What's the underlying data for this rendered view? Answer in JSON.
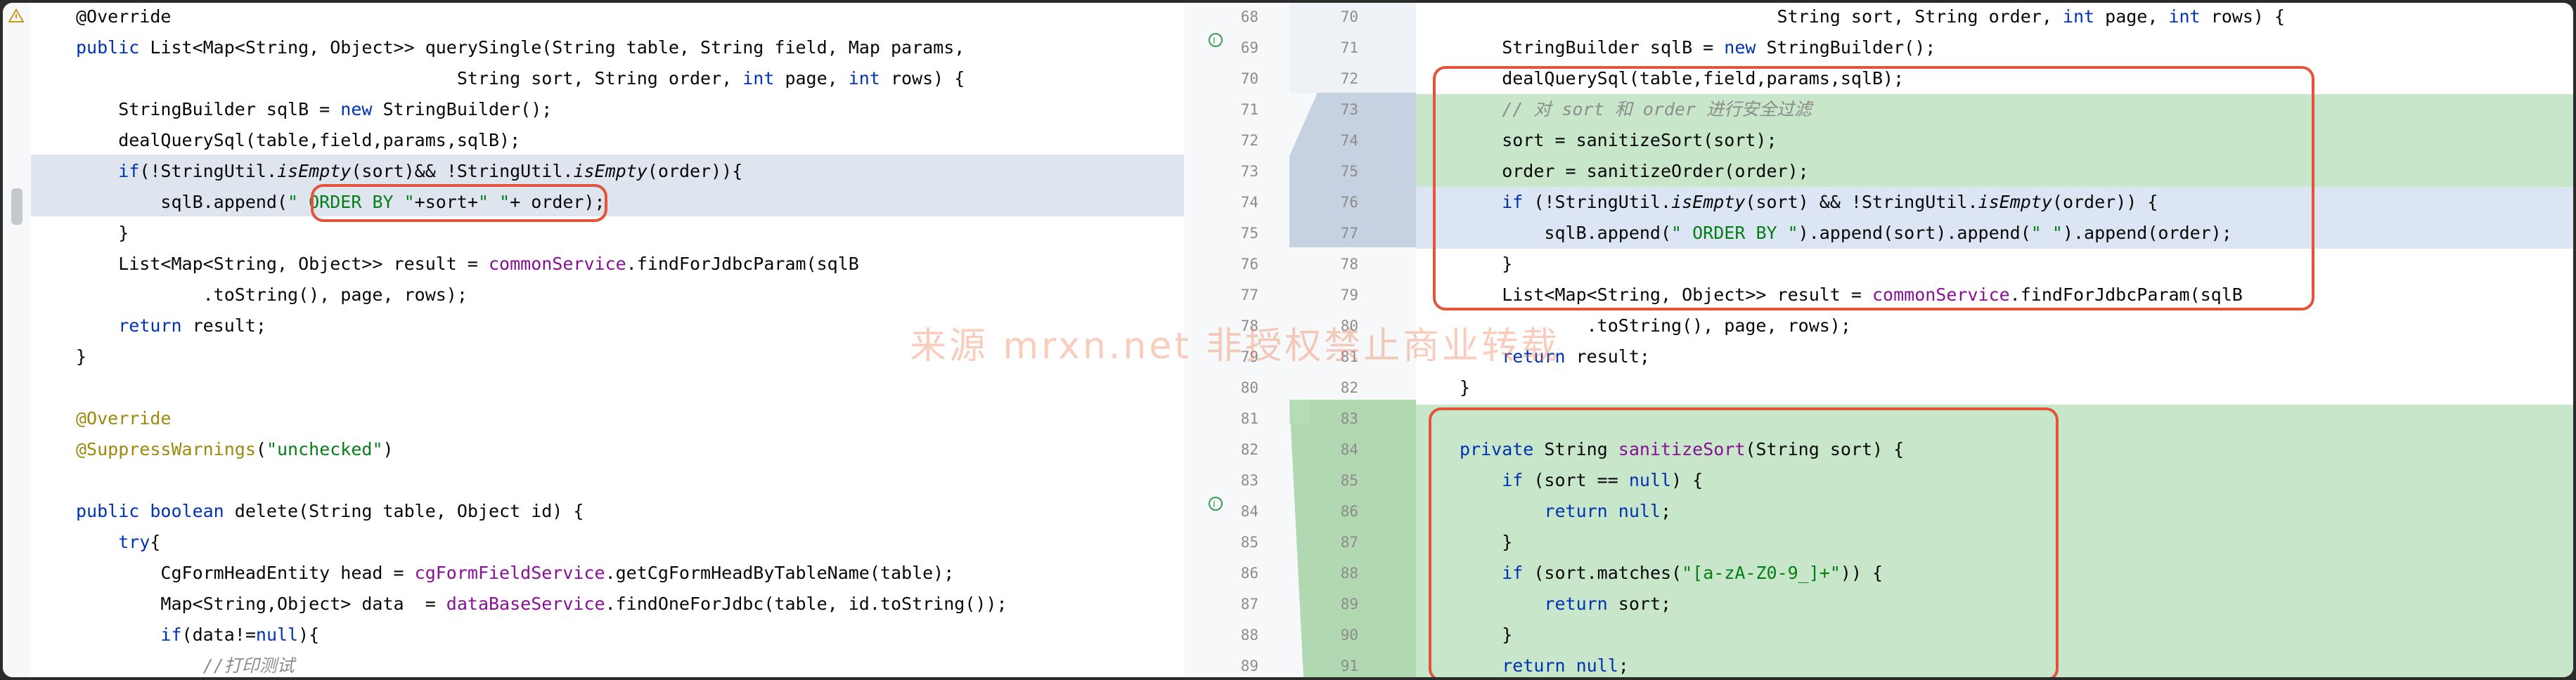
{
  "left_code": [
    {
      "n": "",
      "t": "@Override",
      "kind": "ann"
    },
    {
      "n": "69",
      "html": "<span class='kw'>public</span> List&lt;Map&lt;String, Object&gt;&gt; querySingle(String table, String field, Map params,"
    },
    {
      "n": "70",
      "html": "                                    String sort, String order, <span class='kw'>int</span> page, <span class='kw'>int</span> rows) {"
    },
    {
      "n": "71",
      "html": "    StringBuilder sqlB = <span class='kw'>new</span> StringBuilder();"
    },
    {
      "n": "72",
      "html": "    dealQuerySql(table,field,params,sqlB);"
    },
    {
      "n": "73",
      "html": "    <span class='kw'>if</span>(!StringUtil.<span class='it'>isEmpty</span>(sort)&amp;&amp; !StringUtil.<span class='it'>isEmpty</span>(order)){"
    },
    {
      "n": "74",
      "html": "        sqlB.append(<span class='str'>\" ORDER BY \"</span>+sort+<span class='str'>\" \"</span>+ order);"
    },
    {
      "n": "75",
      "html": "    }"
    },
    {
      "n": "76",
      "html": "    List&lt;Map&lt;String, Object&gt;&gt; result = <span class='fld'>commonService</span>.findForJdbcParam(sqlB"
    },
    {
      "n": "77",
      "html": "            .toString(), page, rows);"
    },
    {
      "n": "78",
      "html": "    <span class='kw'>return</span> result;"
    },
    {
      "n": "79",
      "html": "}"
    },
    {
      "n": "80",
      "html": ""
    },
    {
      "n": "81",
      "html": "<span class='ann'>@Override</span>"
    },
    {
      "n": "82",
      "html": "<span class='ann'>@SuppressWarnings</span>(<span class='str'>\"unchecked\"</span>)"
    },
    {
      "n": "83",
      "html": ""
    },
    {
      "n": "84",
      "html": "<span class='kw'>public boolean</span> delete(String table, Object id) {"
    },
    {
      "n": "85",
      "html": "    <span class='kw'>try</span>{"
    },
    {
      "n": "86",
      "html": "        CgFormHeadEntity head = <span class='fld'>cgFormFieldService</span>.getCgFormHeadByTableName(table);"
    },
    {
      "n": "87",
      "html": "        Map&lt;String,Object&gt; data  = <span class='fld'>dataBaseService</span>.findOneForJdbc(table, id.toString());"
    },
    {
      "n": "88",
      "html": "        <span class='kw'>if</span>(data!=<span class='kw'>null</span>){"
    },
    {
      "n": "89",
      "html": "            <span class='cmt'>//打印测试</span>"
    }
  ],
  "right_code": [
    {
      "n": "70",
      "html": "                              String sort, String order, <span class='kw'>int</span> page, <span class='kw'>int</span> rows) {"
    },
    {
      "n": "71",
      "html": "    StringBuilder sqlB = <span class='kw'>new</span> StringBuilder();"
    },
    {
      "n": "72",
      "html": "    dealQuerySql(table,field,params,sqlB);"
    },
    {
      "n": "73",
      "html": "    <span class='cmt'>// 对 sort 和 order 进行安全过滤</span>"
    },
    {
      "n": "74",
      "html": "    sort = sanitizeSort(sort);"
    },
    {
      "n": "75",
      "html": "    order = sanitizeOrder(order);"
    },
    {
      "n": "76",
      "html": "    <span class='kw'>if</span> (!StringUtil.<span class='it'>isEmpty</span>(sort) &amp;&amp; !StringUtil.<span class='it'>isEmpty</span>(order)) {"
    },
    {
      "n": "77",
      "html": "        sqlB.append(<span class='str'>\" ORDER BY \"</span>).append(sort).append(<span class='str'>\" \"</span>).append(order);"
    },
    {
      "n": "78",
      "html": "    }"
    },
    {
      "n": "79",
      "html": "    List&lt;Map&lt;String, Object&gt;&gt; result = <span class='fld'>commonService</span>.findForJdbcParam(sqlB"
    },
    {
      "n": "80",
      "html": "            .toString(), page, rows);"
    },
    {
      "n": "81",
      "html": "    <span class='kw'>return</span> result;"
    },
    {
      "n": "82",
      "html": "}"
    },
    {
      "n": "83",
      "html": ""
    },
    {
      "n": "84",
      "html": "<span class='kw'>private</span> String <span class='fld'>sanitizeSort</span>(String sort) {"
    },
    {
      "n": "85",
      "html": "    <span class='kw'>if</span> (sort == <span class='kw'>null</span>) {"
    },
    {
      "n": "86",
      "html": "        <span class='kw'>return null</span>;"
    },
    {
      "n": "87",
      "html": "    }"
    },
    {
      "n": "88",
      "html": "    <span class='kw'>if</span> (sort.matches(<span class='str'>\"[a-zA-Z0-9_]+\"</span>)) {"
    },
    {
      "n": "89",
      "html": "        <span class='kw'>return</span> sort;"
    },
    {
      "n": "90",
      "html": "    }"
    },
    {
      "n": "91",
      "html": "    <span class='kw'>return null</span>;"
    }
  ],
  "left_gutter_extra": {
    "n": "68"
  },
  "watermark": "来源 mrxn.net 非授权禁止商业转载",
  "colors": {
    "added": "#c8e6c9",
    "modified": "#dbe5f3",
    "highlight_box": "#e2553a"
  }
}
